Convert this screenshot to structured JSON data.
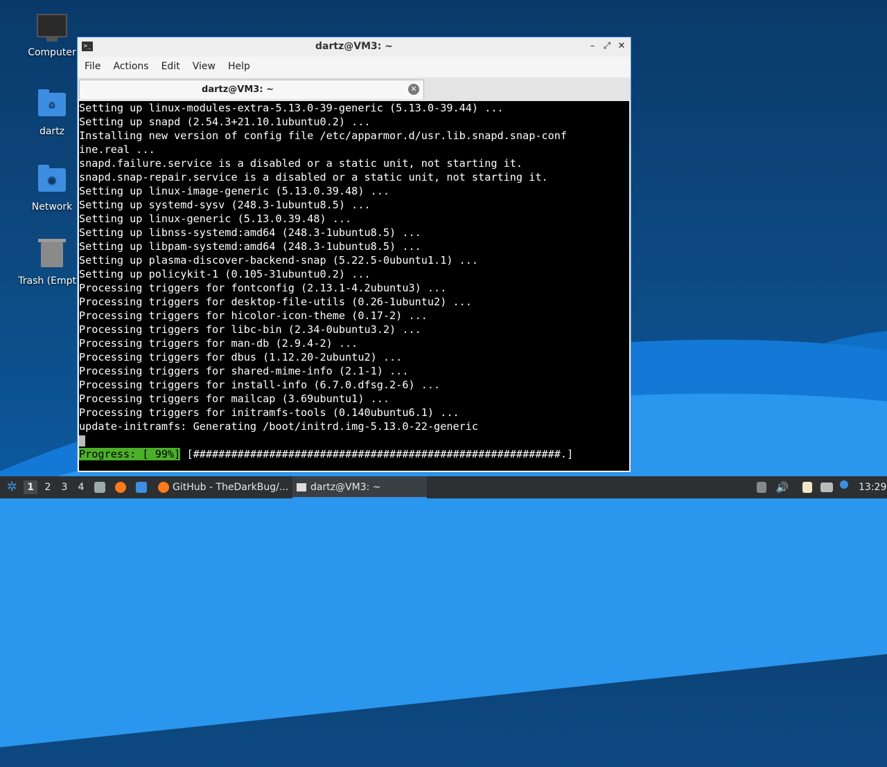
{
  "desktop": {
    "icons": [
      {
        "label": "Computer"
      },
      {
        "label": "dartz"
      },
      {
        "label": "Network"
      },
      {
        "label": "Trash (Empty)"
      }
    ]
  },
  "window": {
    "title": "dartz@VM3: ~",
    "menu": [
      "File",
      "Actions",
      "Edit",
      "View",
      "Help"
    ],
    "tab_title": "dartz@VM3: ~"
  },
  "terminal": {
    "lines": [
      "Setting up linux-modules-extra-5.13.0-39-generic (5.13.0-39.44) ...",
      "Setting up snapd (2.54.3+21.10.1ubuntu0.2) ...",
      "Installing new version of config file /etc/apparmor.d/usr.lib.snapd.snap-conf",
      "ine.real ...",
      "snapd.failure.service is a disabled or a static unit, not starting it.",
      "snapd.snap-repair.service is a disabled or a static unit, not starting it.",
      "Setting up linux-image-generic (5.13.0.39.48) ...",
      "Setting up systemd-sysv (248.3-1ubuntu8.5) ...",
      "Setting up linux-generic (5.13.0.39.48) ...",
      "Setting up libnss-systemd:amd64 (248.3-1ubuntu8.5) ...",
      "Setting up libpam-systemd:amd64 (248.3-1ubuntu8.5) ...",
      "Setting up plasma-discover-backend-snap (5.22.5-0ubuntu1.1) ...",
      "Setting up policykit-1 (0.105-31ubuntu0.2) ...",
      "Processing triggers for fontconfig (2.13.1-4.2ubuntu3) ...",
      "Processing triggers for desktop-file-utils (0.26-1ubuntu2) ...",
      "Processing triggers for hicolor-icon-theme (0.17-2) ...",
      "Processing triggers for libc-bin (2.34-0ubuntu3.2) ...",
      "Processing triggers for man-db (2.9.4-2) ...",
      "Processing triggers for dbus (1.12.20-2ubuntu2) ...",
      "Processing triggers for shared-mime-info (2.1-1) ...",
      "Processing triggers for install-info (6.7.0.dfsg.2-6) ...",
      "Processing triggers for mailcap (3.69ubuntu1) ...",
      "Processing triggers for initramfs-tools (0.140ubuntu6.1) ...",
      "update-initramfs: Generating /boot/initrd.img-5.13.0-22-generic"
    ],
    "progress_label": "Progress: [ 99%]",
    "progress_bar": " [##########################################################.]"
  },
  "taskbar": {
    "workspaces": [
      "1",
      "2",
      "3",
      "4"
    ],
    "tasks": [
      {
        "label": "GitHub - TheDarkBug/..."
      },
      {
        "label": "dartz@VM3: ~"
      }
    ],
    "clock": "13:29"
  }
}
